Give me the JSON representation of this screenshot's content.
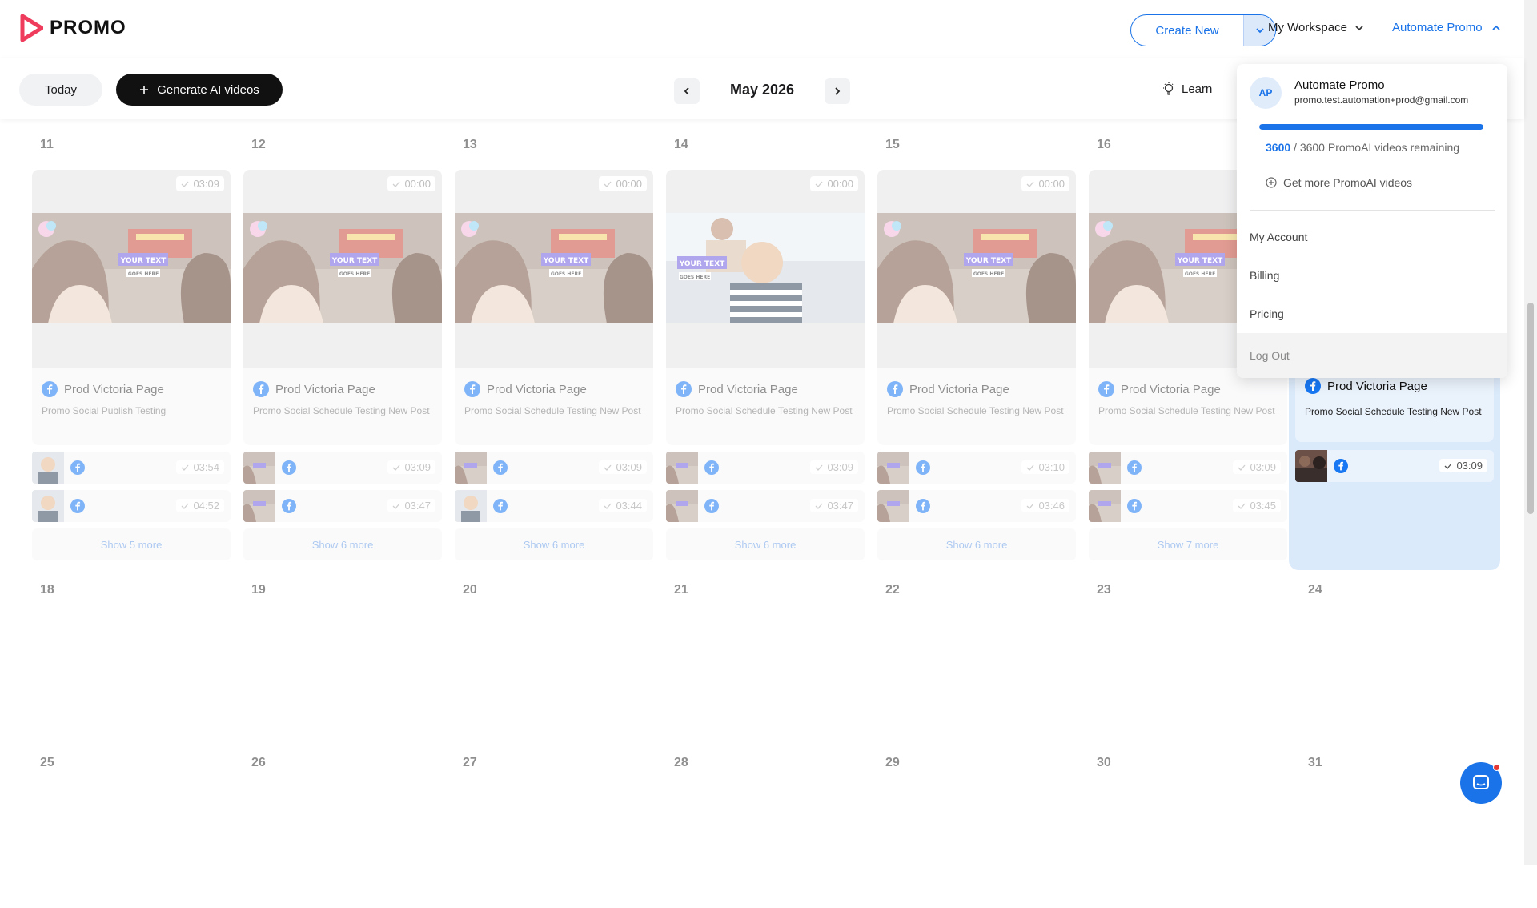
{
  "brand": {
    "name": "PROMO"
  },
  "header": {
    "create_new": "Create New",
    "workspace": "My Workspace",
    "account": "Automate Promo"
  },
  "toolbar": {
    "today": "Today",
    "generate": "Generate AI videos",
    "month": "May 2026",
    "learn": "Learn"
  },
  "week1": [
    {
      "num": "11",
      "dur": "03:09",
      "page": "Prod Victoria Page",
      "title": "Promo Social Publish Testing",
      "mini": [
        "03:54",
        "04:52"
      ],
      "more": "Show 5 more"
    },
    {
      "num": "12",
      "dur": "00:00",
      "page": "Prod Victoria Page",
      "title": "Promo Social Schedule Testing New Post",
      "mini": [
        "03:09",
        "03:47"
      ],
      "more": "Show 6 more"
    },
    {
      "num": "13",
      "dur": "00:00",
      "page": "Prod Victoria Page",
      "title": "Promo Social Schedule Testing New Post",
      "mini": [
        "03:09",
        "03:44"
      ],
      "more": "Show 6 more"
    },
    {
      "num": "14",
      "dur": "00:00",
      "page": "Prod Victoria Page",
      "title": "Promo Social Schedule Testing New Post",
      "mini": [
        "03:09",
        "03:47"
      ],
      "more": "Show 6 more"
    },
    {
      "num": "15",
      "dur": "00:00",
      "page": "Prod Victoria Page",
      "title": "Promo Social Schedule Testing New Post",
      "mini": [
        "03:10",
        "03:46"
      ],
      "more": "Show 6 more"
    },
    {
      "num": "16",
      "dur": "",
      "page": "Prod Victoria Page",
      "title": "Promo Social Schedule Testing New Post",
      "mini": [
        "03:09",
        "03:45"
      ],
      "more": "Show 7 more"
    }
  ],
  "highlight_day": {
    "page": "Prod Victoria Page",
    "title": "Promo Social Schedule Testing New Post",
    "mini": "03:09"
  },
  "week2": [
    "18",
    "19",
    "20",
    "21",
    "22",
    "23",
    "24"
  ],
  "week3": [
    "25",
    "26",
    "27",
    "28",
    "29",
    "30",
    "31"
  ],
  "thumb_text": {
    "line1": "YOUR TEXT",
    "line2": "GOES HERE"
  },
  "dropdown": {
    "initials": "AP",
    "name": "Automate Promo",
    "email": "promo.test.automation+prod@gmail.com",
    "remaining_count": "3600",
    "remaining_rest": " / 3600 PromoAI videos remaining",
    "progress": 1.0,
    "get_more": "Get more PromoAI videos",
    "items": [
      "My Account",
      "Billing",
      "Pricing",
      "Log Out"
    ]
  },
  "colors": {
    "accent": "#1a73e8",
    "facebook": "#1877f2"
  }
}
